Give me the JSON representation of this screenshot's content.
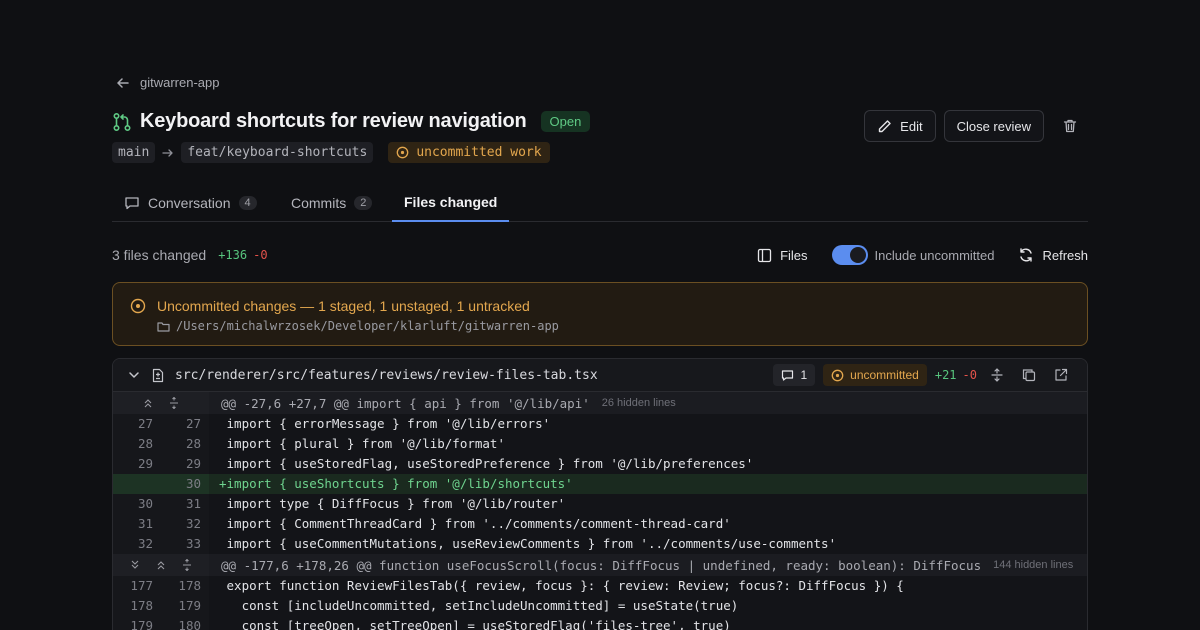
{
  "header": {
    "back_label": "gitwarren-app",
    "title": "Keyboard shortcuts for review navigation",
    "status": "Open",
    "base_branch": "main",
    "head_branch": "feat/keyboard-shortcuts",
    "work_badge": "uncommitted work"
  },
  "actions": {
    "edit": "Edit",
    "close": "Close review"
  },
  "tabs": [
    {
      "label": "Conversation",
      "count": "4"
    },
    {
      "label": "Commits",
      "count": "2"
    },
    {
      "label": "Files changed"
    }
  ],
  "stats": {
    "files_changed": "3 files changed",
    "additions": "+136",
    "deletions": "-0",
    "files_button": "Files",
    "include_uncommitted": "Include uncommitted",
    "include_uncommitted_on": true,
    "refresh": "Refresh"
  },
  "banner": {
    "title": "Uncommitted changes — 1 staged, 1 unstaged, 1 untracked",
    "path": "/Users/michalwrzosek/Developer/klarluft/gitwarren-app"
  },
  "file": {
    "path": "src/renderer/src/features/reviews/review-files-tab.tsx",
    "comments": "1",
    "badge": "uncommitted",
    "additions": "+21",
    "deletions": "-0",
    "hunk1": {
      "header": "@@ -27,6 +27,7 @@ import { api } from '@/lib/api'",
      "hidden": "26 hidden lines"
    },
    "hunk2": {
      "header": "@@ -177,6 +178,26 @@ function useFocusScroll(focus: DiffFocus | undefined, ready: boolean): DiffFocus",
      "hidden": "144 hidden lines"
    },
    "lines1": [
      {
        "old": "27",
        "new": "27",
        "code": " import { errorMessage } from '@/lib/errors'"
      },
      {
        "old": "28",
        "new": "28",
        "code": " import { plural } from '@/lib/format'"
      },
      {
        "old": "29",
        "new": "29",
        "code": " import { useStoredFlag, useStoredPreference } from '@/lib/preferences'"
      },
      {
        "old": "",
        "new": "30",
        "code": "+import { useShortcuts } from '@/lib/shortcuts'",
        "added": true
      },
      {
        "old": "30",
        "new": "31",
        "code": " import type { DiffFocus } from '@/lib/router'"
      },
      {
        "old": "31",
        "new": "32",
        "code": " import { CommentThreadCard } from '../comments/comment-thread-card'"
      },
      {
        "old": "32",
        "new": "33",
        "code": " import { useCommentMutations, useReviewComments } from '../comments/use-comments'"
      }
    ],
    "lines2": [
      {
        "old": "177",
        "new": "178",
        "code": " export function ReviewFilesTab({ review, focus }: { review: Review; focus?: DiffFocus }) {"
      },
      {
        "old": "178",
        "new": "179",
        "code": "   const [includeUncommitted, setIncludeUncommitted] = useState(true)"
      },
      {
        "old": "179",
        "new": "180",
        "code": "   const [treeOpen, setTreeOpen] = useStoredFlag('files-tree', true)"
      }
    ]
  }
}
